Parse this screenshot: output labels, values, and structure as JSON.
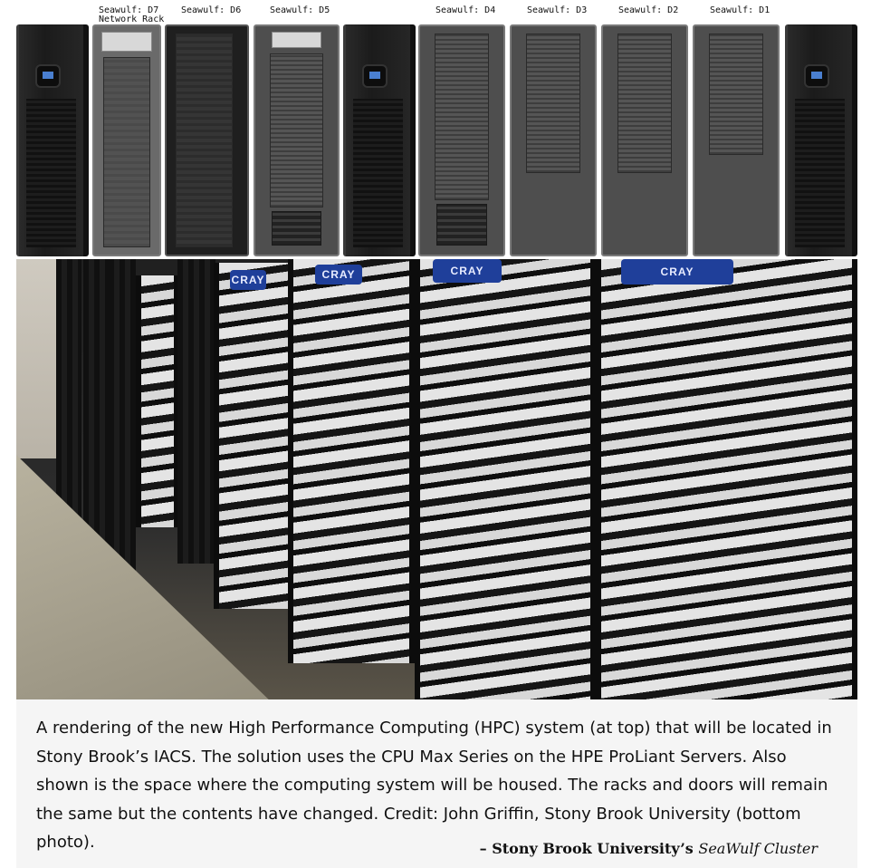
{
  "rack_labels": {
    "d7": "Seawulf: D7\nNetwork Rack",
    "d6": "Seawulf: D6",
    "d5": "Seawulf: D5",
    "d4": "Seawulf: D4",
    "d3": "Seawulf: D3",
    "d2": "Seawulf: D2",
    "d1": "Seawulf: D1"
  },
  "photo_badges": [
    "CRAY",
    "CRAY",
    "CRAY",
    "CRAY"
  ],
  "caption": {
    "text": "A rendering of the new High Performance Computing (HPC) system (at top) that will be located in Stony Brook’s IACS. The solution uses the CPU Max Series on the HPE ProLiant Servers. Also shown is the space where the computing system will be housed. The racks and doors will remain the same but the contents have changed.  Credit: John Griffin, Stony Brook University (bottom photo).",
    "attribution_prefix": "– Stony Brook University’s ",
    "attribution_cluster": "SeaWulf Cluster"
  }
}
